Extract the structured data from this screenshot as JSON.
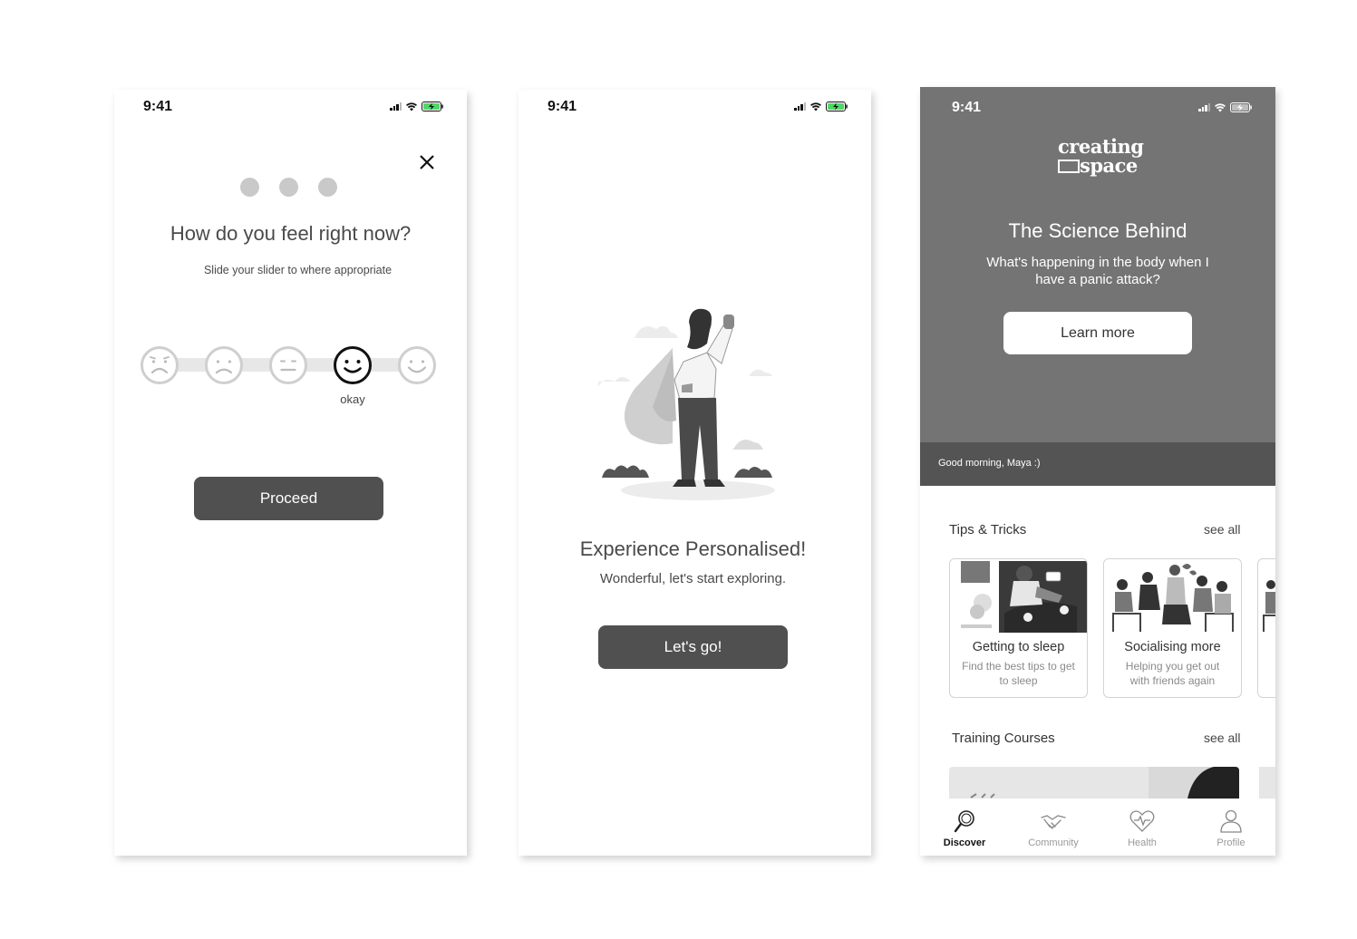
{
  "screen1": {
    "time": "9:41",
    "title": "How do you feel right now?",
    "subtitle": "Slide your slider to where appropriate",
    "faces": [
      "very-sad",
      "sad",
      "neutral",
      "okay",
      "happy"
    ],
    "selected_index": 3,
    "selected_label": "okay",
    "proceed_label": "Proceed"
  },
  "screen2": {
    "time": "9:41",
    "title": "Experience Personalised!",
    "subtitle": "Wonderful, let's start exploring.",
    "button_label": "Let's go!"
  },
  "screen3": {
    "time": "9:41",
    "logo_line1": "creating",
    "logo_line2": "space",
    "hero_title": "The Science Behind",
    "hero_subtitle": "What's happening in the body when I have a panic attack?",
    "learn_more_label": "Learn more",
    "greeting": "Good morning, Maya :)",
    "tips_title": "Tips & Tricks",
    "see_all": "see all",
    "cards": [
      {
        "title": "Getting to sleep",
        "desc": "Find the best tips to get to sleep"
      },
      {
        "title": "Socialising more",
        "desc": "Helping you get out with friends again"
      }
    ],
    "courses_title": "Training Courses",
    "tabs": [
      {
        "label": "Discover",
        "icon": "magnifier-icon",
        "active": true
      },
      {
        "label": "Community",
        "icon": "handshake-icon",
        "active": false
      },
      {
        "label": "Health",
        "icon": "heartbeat-icon",
        "active": false
      },
      {
        "label": "Profile",
        "icon": "person-icon",
        "active": false
      }
    ]
  },
  "colors": {
    "dark_button": "#505050",
    "hero_bg": "#747474",
    "greeting_bar": "#545454",
    "slider_track": "#e7e7e7"
  }
}
